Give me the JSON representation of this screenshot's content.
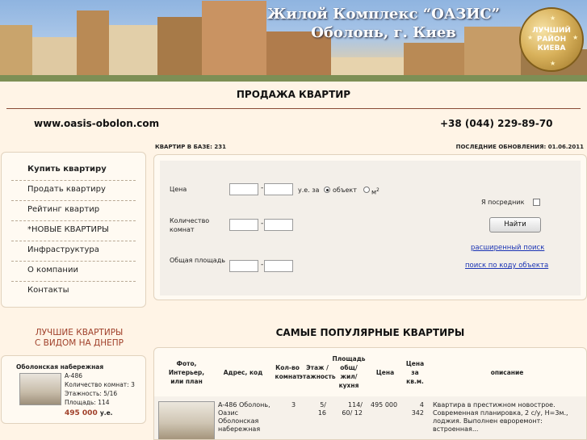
{
  "banner": {
    "title_line1": "Жилой Комплекс “ОАЗИС”",
    "title_line2": "Оболонь, г. Киев",
    "medal_lines": [
      "ЛУЧШИЙ",
      "РАЙОН",
      "КИЕВА"
    ]
  },
  "header": {
    "page_title": "ПРОДАЖА КВАРТИР",
    "site_url": "www.oasis-obolon.com",
    "phone": "+38 (044) 229-89-70",
    "db_count": "КВАРТИР В БАЗЕ: 231",
    "last_update": "ПОСЛЕДНИЕ ОБНОВЛЕНИЯ: 01.06.2011"
  },
  "menu": {
    "items": [
      {
        "label": "Купить квартиру"
      },
      {
        "label": "Продать квартиру"
      },
      {
        "label": "Рейтинг квартир"
      },
      {
        "label": "*НОВЫЕ КВАРТИРЫ"
      },
      {
        "label": "Инфраструктура"
      },
      {
        "label": "О компании"
      },
      {
        "label": "Контакты"
      }
    ]
  },
  "best": {
    "title_line1": "ЛУЧШИЕ КВАРТИРЫ",
    "title_line2": "С ВИДОМ НА ДНЕПР",
    "location": "Оболонская набережная",
    "code": "A-486",
    "rooms": "Количество комнат: 3",
    "floor": "Этажность: 5/16",
    "area": "Площадь: 114",
    "price": "495 000",
    "currency": "у.е."
  },
  "search": {
    "price_label": "Цена",
    "rooms_label": "Количество комнат",
    "area_label": "Общая площадь",
    "dash": "-",
    "unit_label": "у.е. за",
    "per_object_label": "объект",
    "per_m2_label": "м",
    "per_m2_sup": "2",
    "agent_label": "Я посредник",
    "find_button": "Найти",
    "advanced_link": "расширенный поиск",
    "code_link": "поиск по коду объекта",
    "per_object_selected": true
  },
  "popular": {
    "title": "САМЫЕ ПОПУЛЯРНЫЕ КВАРТИРЫ",
    "columns": [
      "Фото, Интерьер, или план",
      "Адрес, код",
      "Кол-во комнат",
      "Этаж / этажность",
      "Площадь общ/ жил/ кухня",
      "Цена",
      "Цена за кв.м.",
      "описание"
    ],
    "rows": [
      {
        "address": "A-486 Оболонь, Оазис Оболонская набережная",
        "rooms": "3",
        "floor": "5/ 16",
        "area": "114/ 60/ 12",
        "price": "495 000",
        "price_m2": "4 342",
        "description": "Квартира в престижном новострое. Современная планировка, 2 с/у, Н=3м., лоджия. Выполнен евроремонт: встроенная..."
      }
    ]
  },
  "colors": {
    "background": "#fff4e6",
    "accent": "#a0402a",
    "link": "#1a33b4"
  }
}
